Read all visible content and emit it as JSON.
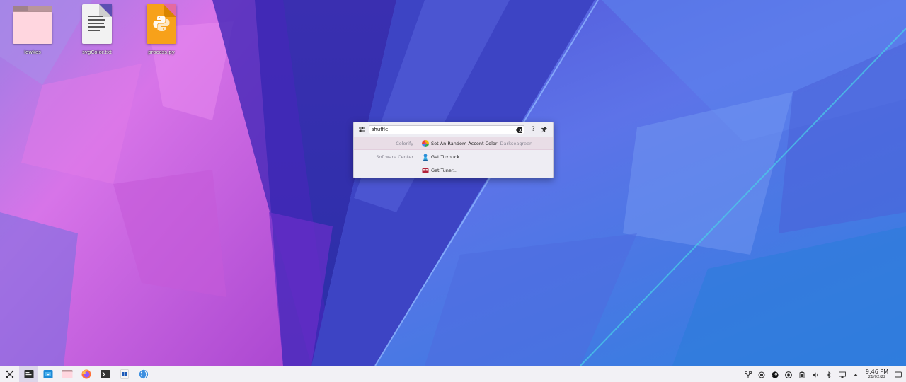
{
  "desktop": {
    "icons": [
      {
        "caption": "lowkas",
        "icon": "folder-icon"
      },
      {
        "caption": "svgColor.txt",
        "icon": "text-file-icon"
      },
      {
        "caption": "process.py",
        "icon": "python-file-icon"
      }
    ]
  },
  "krunner": {
    "query": "shuffle",
    "help_label": "?",
    "results": [
      {
        "category": "Colorify",
        "label": "Set An Random Accent Color",
        "sublabel": "Darkseagreen",
        "icon": "color-wheel-icon",
        "selected": true
      },
      {
        "category": "Software Center",
        "label": "Get Tuxpuck...",
        "sublabel": "",
        "icon": "tuxpuck-icon",
        "selected": false
      },
      {
        "category": "",
        "label": "Get Tuner...",
        "sublabel": "",
        "icon": "tuner-icon",
        "selected": false
      }
    ]
  },
  "panel": {
    "tasks": [
      "app-launcher-icon",
      "terminal-icon",
      "discover-icon",
      "dolphin-icon",
      "firefox-icon",
      "konsole-icon",
      "text-editor-icon",
      "globe-icon"
    ],
    "tray": [
      "network-icon",
      "clipboard-icon",
      "steam-icon",
      "vault-icon",
      "battery-icon",
      "volume-icon",
      "bluetooth-icon",
      "display-icon",
      "expand-icon"
    ],
    "clock": {
      "time": "9:46 PM",
      "date": "21/02/22"
    }
  },
  "colors": {
    "accent": "#e46aa0",
    "panel_bg": "#f2f1f5",
    "selected_row": "#e9dde6",
    "wallpaper_pink": "#d86ce0",
    "wallpaper_blue": "#3e4bd6"
  }
}
